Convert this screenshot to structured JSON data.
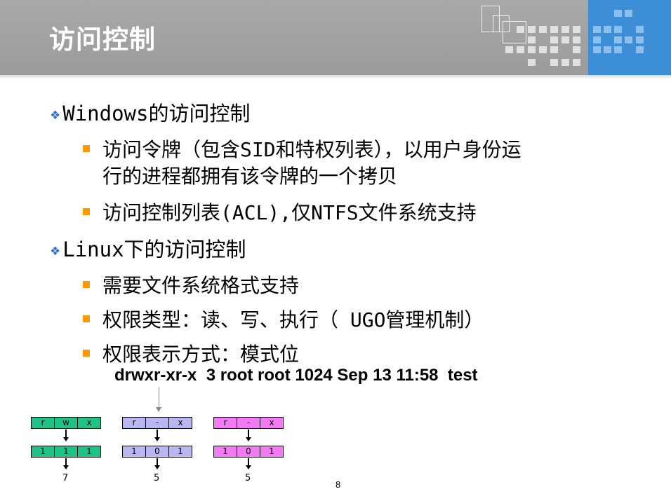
{
  "title": "访问控制",
  "bullets": [
    {
      "text": "Windows的访问控制",
      "subs": [
        {
          "lines": [
            "访问令牌（包含SID和特权列表），以用户身份运",
            "行的进程都拥有该令牌的一个拷贝"
          ]
        },
        {
          "lines": [
            "访问控制列表(ACL),仅NTFS文件系统支持"
          ]
        }
      ]
    },
    {
      "text": "Linux下的访问控制",
      "subs": [
        {
          "lines": [
            "需要文件系统格式支持"
          ]
        },
        {
          "lines": [
            "权限类型：读、写、执行（ UGO管理机制）"
          ]
        },
        {
          "lines": [
            "权限表示方式：模式位"
          ]
        }
      ]
    }
  ],
  "permission_example": "drwxr-xr-x  3 root root 1024 Sep 13 11:58  test",
  "perm_groups": [
    {
      "chars": [
        "r",
        "w",
        "x"
      ],
      "bits": [
        "1",
        "1",
        "1"
      ],
      "value": "7",
      "color": "#1fc38a"
    },
    {
      "chars": [
        "r",
        "-",
        "x"
      ],
      "bits": [
        "1",
        "0",
        "1"
      ],
      "value": "5",
      "color": "#b9b7f2"
    },
    {
      "chars": [
        "r",
        "-",
        "x"
      ],
      "bits": [
        "1",
        "0",
        "1"
      ],
      "value": "5",
      "color": "#f27af2"
    }
  ],
  "page_number": "8"
}
